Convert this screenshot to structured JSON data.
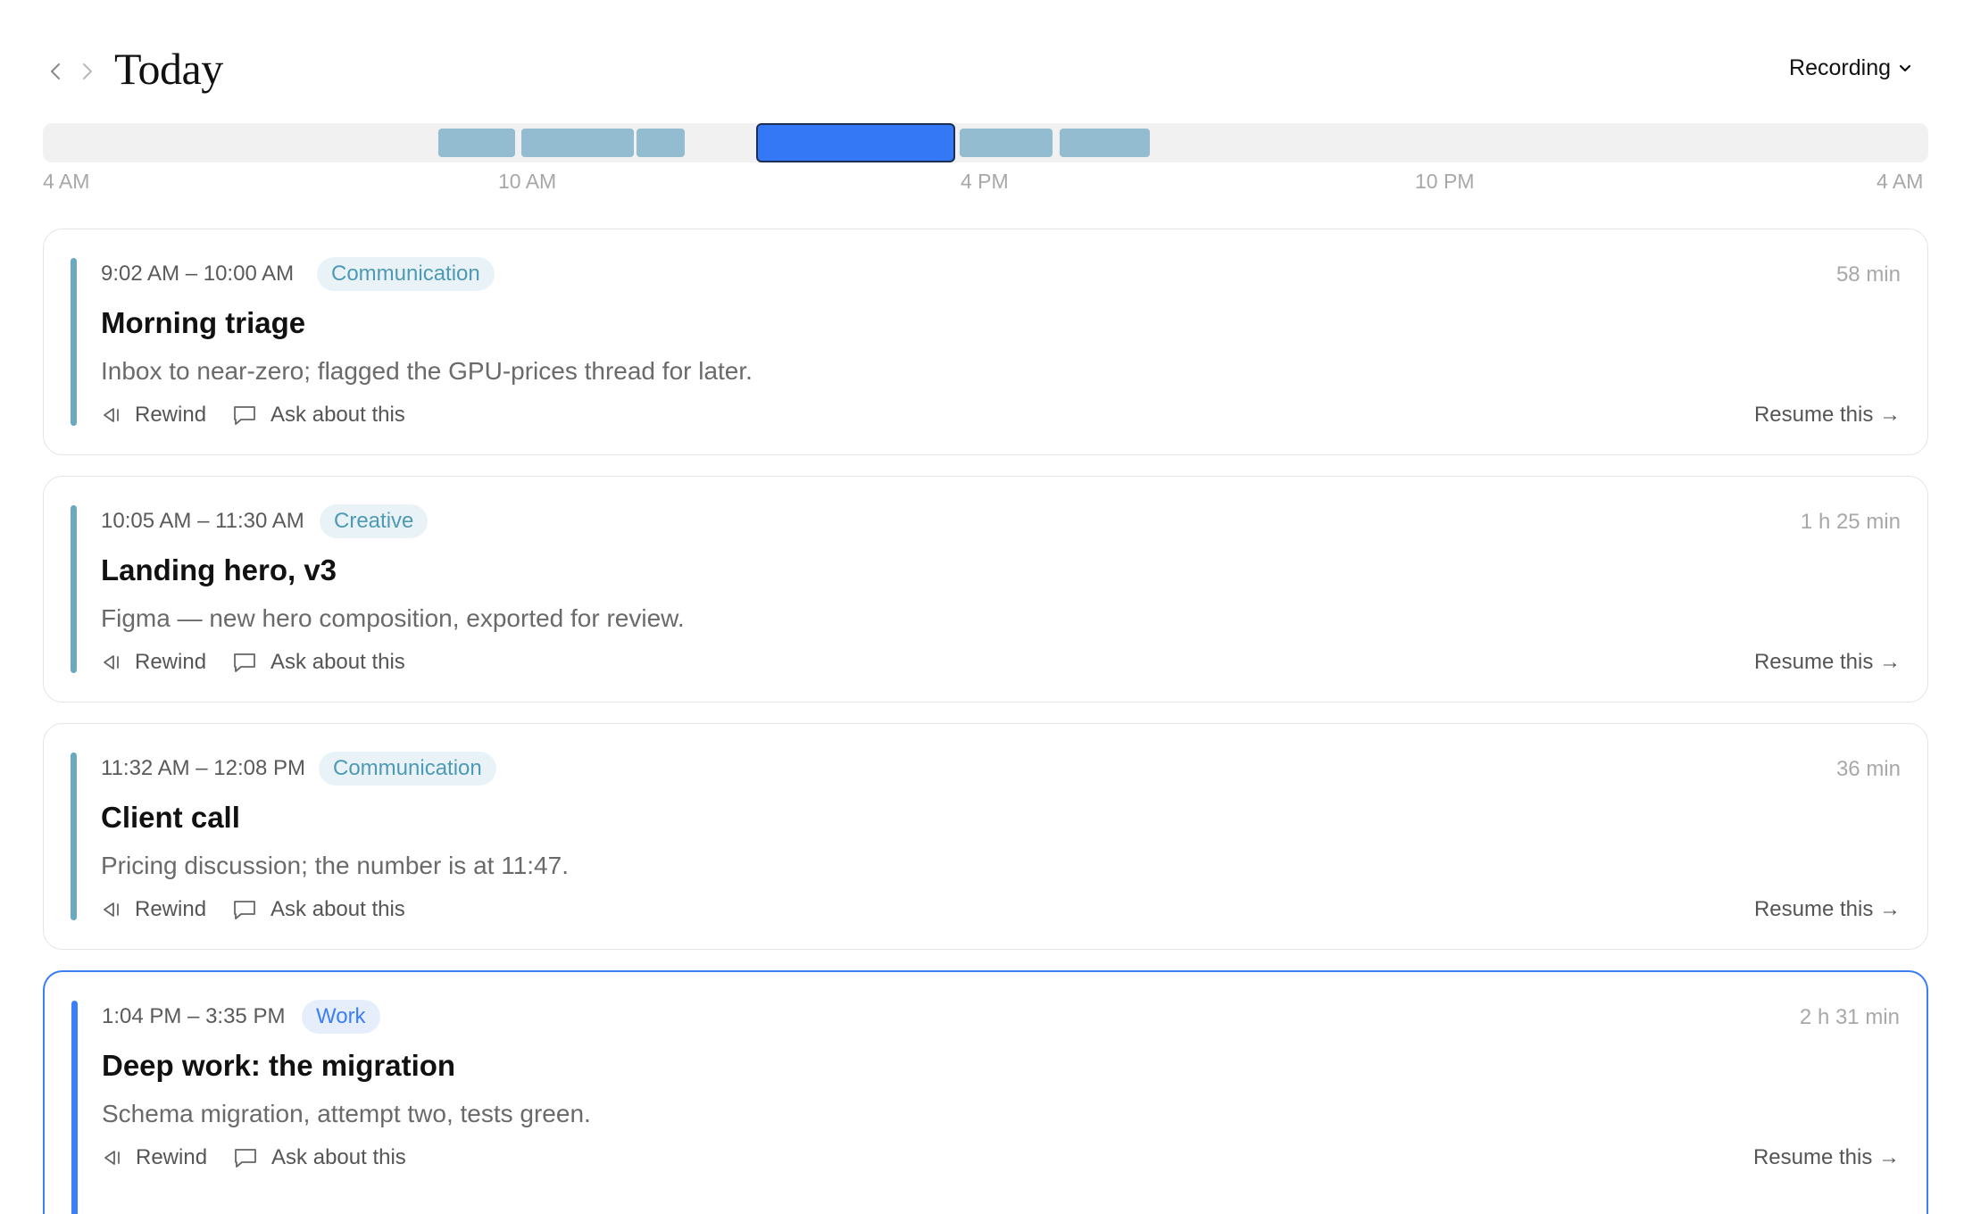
{
  "header": {
    "title": "Today",
    "recording_label": "Recording"
  },
  "timeline": {
    "ticks": [
      "4 AM",
      "10 AM",
      "4 PM",
      "10 PM",
      "4 AM"
    ]
  },
  "cards": [
    {
      "time": "9:02 AM – 10:00 AM",
      "tag": "Communication",
      "duration": "58 min",
      "title": "Morning triage",
      "description": "Inbox to near-zero; flagged the GPU-prices thread for later.",
      "rewind": "Rewind",
      "ask": "Ask about this",
      "resume": "Resume this →"
    },
    {
      "time": "10:05 AM – 11:30 AM",
      "tag": "Creative",
      "duration": "1 h 25 min",
      "title": "Landing hero, v3",
      "description": "Figma — new hero composition, exported for review.",
      "rewind": "Rewind",
      "ask": "Ask about this",
      "resume": "Resume this →"
    },
    {
      "time": "11:32 AM – 12:08 PM",
      "tag": "Communication",
      "duration": "36 min",
      "title": "Client call",
      "description": "Pricing discussion; the number is at 11:47.",
      "rewind": "Rewind",
      "ask": "Ask about this",
      "resume": "Resume this →"
    },
    {
      "time": "1:04 PM – 3:35 PM",
      "tag": "Work",
      "duration": "2 h 31 min",
      "title": "Deep work: the migration",
      "description": "Schema migration, attempt two, tests green.",
      "rewind": "Rewind",
      "ask": "Ask about this",
      "resume": "Resume this →"
    }
  ],
  "colors": {
    "accent": "#3478f6",
    "segment": "#93bcd0",
    "category_bar": "#6aa9bf",
    "tag_text": "#4e9ab5"
  }
}
